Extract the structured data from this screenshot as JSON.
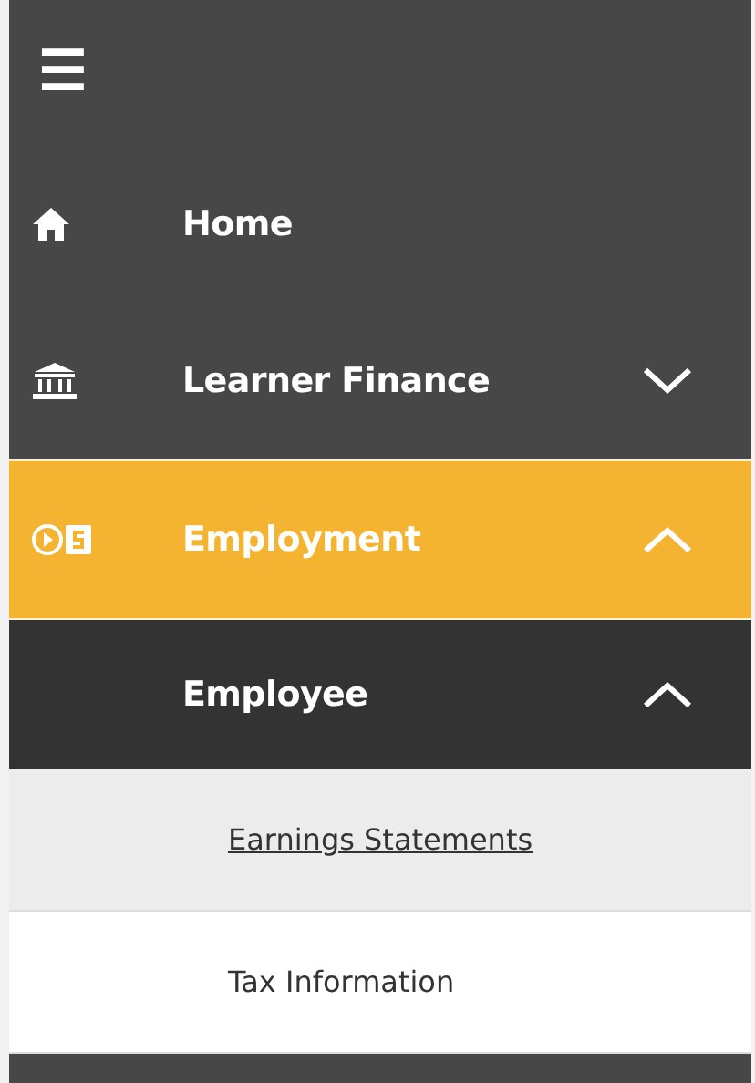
{
  "menu_button": {
    "icon": "☰"
  },
  "nav_items": [
    {
      "label": "Home",
      "kind": "home",
      "active": false
    },
    {
      "label": "Learner Finance",
      "kind": "finance",
      "active": false,
      "expanded": false
    },
    {
      "label": "Employment",
      "kind": "employment",
      "active": true,
      "expanded": true
    }
  ],
  "sub_group": {
    "label": "Employee",
    "expanded": true,
    "items": [
      {
        "label": "Earnings Statements",
        "selected": true
      },
      {
        "label": "Tax Information",
        "selected": false
      }
    ]
  }
}
